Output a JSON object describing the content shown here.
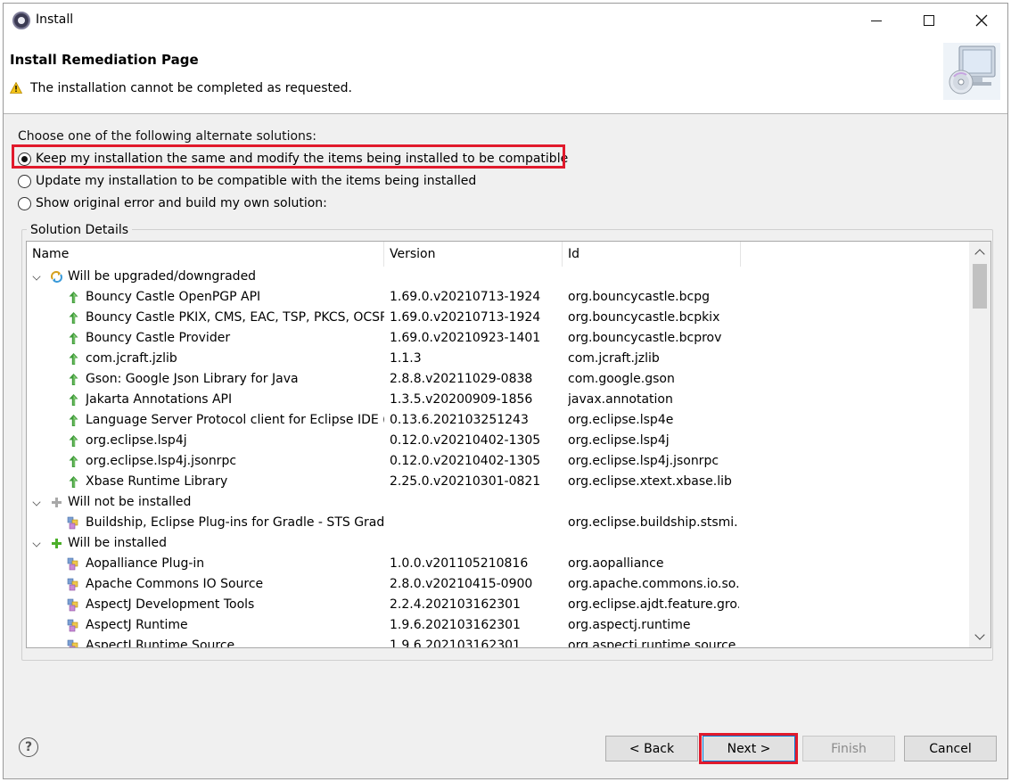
{
  "window": {
    "title": "Install"
  },
  "banner": {
    "title": "Install Remediation Page",
    "message": "The installation cannot be completed as requested."
  },
  "options": {
    "prompt": "Choose one of the following alternate solutions:",
    "items": [
      {
        "label": "Keep my installation the same and modify the items being installed to be compatible",
        "selected": true
      },
      {
        "label": "Update my installation to be compatible with the items being installed",
        "selected": false
      },
      {
        "label": "Show original error and build my own solution:",
        "selected": false
      }
    ]
  },
  "details": {
    "group_label": "Solution Details",
    "columns": [
      "Name",
      "Version",
      "Id"
    ],
    "groups": [
      {
        "label": "Will be upgraded/downgraded",
        "icon": "upgrade-icon",
        "rows": [
          {
            "name": "Bouncy Castle OpenPGP API",
            "version": "1.69.0.v20210713-1924",
            "id": "org.bouncycastle.bcpg",
            "icon": "green-up-arrow-icon"
          },
          {
            "name": "Bouncy Castle PKIX, CMS, EAC, TSP, PKCS, OCSP, CMP, and CRMF APIs",
            "version": "1.69.0.v20210713-1924",
            "id": "org.bouncycastle.bcpkix",
            "icon": "green-up-arrow-icon"
          },
          {
            "name": "Bouncy Castle Provider",
            "version": "1.69.0.v20210923-1401",
            "id": "org.bouncycastle.bcprov",
            "icon": "green-up-arrow-icon"
          },
          {
            "name": "com.jcraft.jzlib",
            "version": "1.1.3",
            "id": "com.jcraft.jzlib",
            "icon": "green-up-arrow-icon"
          },
          {
            "name": "Gson: Google Json Library for Java",
            "version": "2.8.8.v20211029-0838",
            "id": "com.google.gson",
            "icon": "green-up-arrow-icon"
          },
          {
            "name": "Jakarta Annotations API",
            "version": "1.3.5.v20200909-1856",
            "id": "javax.annotation",
            "icon": "green-up-arrow-icon"
          },
          {
            "name": "Language Server Protocol client for Eclipse IDE (Incubation)",
            "version": "0.13.6.202103251243",
            "id": "org.eclipse.lsp4e",
            "icon": "green-up-arrow-icon"
          },
          {
            "name": "org.eclipse.lsp4j",
            "version": "0.12.0.v20210402-1305",
            "id": "org.eclipse.lsp4j",
            "icon": "green-up-arrow-icon"
          },
          {
            "name": "org.eclipse.lsp4j.jsonrpc",
            "version": "0.12.0.v20210402-1305",
            "id": "org.eclipse.lsp4j.jsonrpc",
            "icon": "green-up-arrow-icon"
          },
          {
            "name": "Xbase Runtime Library",
            "version": "2.25.0.v20210301-0821",
            "id": "org.eclipse.xtext.xbase.lib",
            "icon": "green-up-arrow-icon"
          }
        ]
      },
      {
        "label": "Will not be installed",
        "icon": "gray-plus-icon",
        "rows": [
          {
            "name": "Buildship, Eclipse Plug-ins for Gradle - STS Gradle Integration",
            "version": "",
            "id": "org.eclipse.buildship.stsmi...",
            "icon": "feature-icon"
          }
        ]
      },
      {
        "label": "Will be installed",
        "icon": "green-plus-icon",
        "rows": [
          {
            "name": "Aopalliance Plug-in",
            "version": "1.0.0.v201105210816",
            "id": "org.aopalliance",
            "icon": "feature-icon"
          },
          {
            "name": "Apache Commons IO Source",
            "version": "2.8.0.v20210415-0900",
            "id": "org.apache.commons.io.so...",
            "icon": "feature-icon"
          },
          {
            "name": "AspectJ Development Tools",
            "version": "2.2.4.202103162301",
            "id": "org.eclipse.ajdt.feature.gro...",
            "icon": "feature-icon"
          },
          {
            "name": "AspectJ Runtime",
            "version": "1.9.6.202103162301",
            "id": "org.aspectj.runtime",
            "icon": "feature-icon"
          },
          {
            "name": "AspectJ Runtime Source",
            "version": "1.9.6.202103162301",
            "id": "org.aspectj.runtime.source",
            "icon": "feature-icon"
          }
        ]
      }
    ]
  },
  "buttons": {
    "help": "?",
    "back": "< Back",
    "next": "Next >",
    "finish": "Finish",
    "cancel": "Cancel"
  }
}
